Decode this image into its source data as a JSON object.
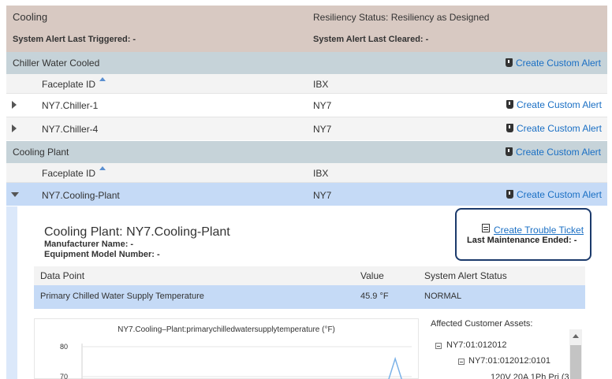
{
  "header": {
    "title": "Cooling",
    "resiliency": "Resiliency Status: Resiliency as Designed",
    "alert_last_triggered": "System Alert Last Triggered: -",
    "alert_last_cleared": "System Alert Last Cleared: -"
  },
  "sections": [
    {
      "title": "Chiller Water Cooled",
      "custom_alert_label": "Create Custom Alert",
      "columns": {
        "faceplate": "Faceplate ID",
        "ibx": "IBX"
      },
      "rows": [
        {
          "id": "NY7.Chiller-1",
          "ibx": "NY7",
          "action": "Create Custom Alert"
        },
        {
          "id": "NY7.Chiller-4",
          "ibx": "NY7",
          "action": "Create Custom Alert"
        }
      ]
    },
    {
      "title": "Cooling Plant",
      "custom_alert_label": "Create Custom Alert",
      "columns": {
        "faceplate": "Faceplate ID",
        "ibx": "IBX"
      },
      "rows": [
        {
          "id": "NY7.Cooling-Plant",
          "ibx": "NY7",
          "action": "Create Custom Alert"
        }
      ]
    }
  ],
  "detail": {
    "title": "Cooling Plant: NY7.Cooling-Plant",
    "manufacturer": "Manufacturer Name: -",
    "model": "Equipment Model Number: -",
    "ticket_label": "Create Trouble Ticket",
    "last_maintenance": "Last Maintenance Ended: -",
    "table": {
      "headers": {
        "data_point": "Data Point",
        "value": "Value",
        "status": "System Alert Status"
      },
      "rows": [
        {
          "data_point": "Primary Chilled Water Supply Temperature",
          "value": "45.9 °F",
          "status": "NORMAL"
        }
      ]
    },
    "assets": {
      "title": "Affected Customer Assets:",
      "items": [
        {
          "label": "NY7:01:012012",
          "level": 0
        },
        {
          "label": "NY7:01:012012:0101",
          "level": 1
        },
        {
          "label": "120V 20A 1Ph Pri (3",
          "level": 2
        }
      ]
    }
  },
  "chart_data": {
    "type": "line",
    "title": "NY7.Cooling–Plant:primarychilledwatersupplytemperature (°F)",
    "yticks": [
      "80",
      "70"
    ],
    "ylim": [
      60,
      80
    ],
    "series": [
      {
        "color": "#7ab2e8",
        "points": [
          [
            0.0,
            60
          ],
          [
            0.93,
            60
          ],
          [
            0.95,
            76
          ],
          [
            0.97,
            60
          ],
          [
            1.0,
            60
          ]
        ]
      }
    ],
    "colors": {
      "line": "#7ab2e8",
      "axis": "#d0d0d0"
    }
  },
  "colors": {
    "link": "#1a6fc4",
    "header_bg": "#d8c9c2",
    "section_bg": "#c6d3d9",
    "selected_bg": "#c5daf6",
    "ticket_border": "#1b3a6b"
  }
}
